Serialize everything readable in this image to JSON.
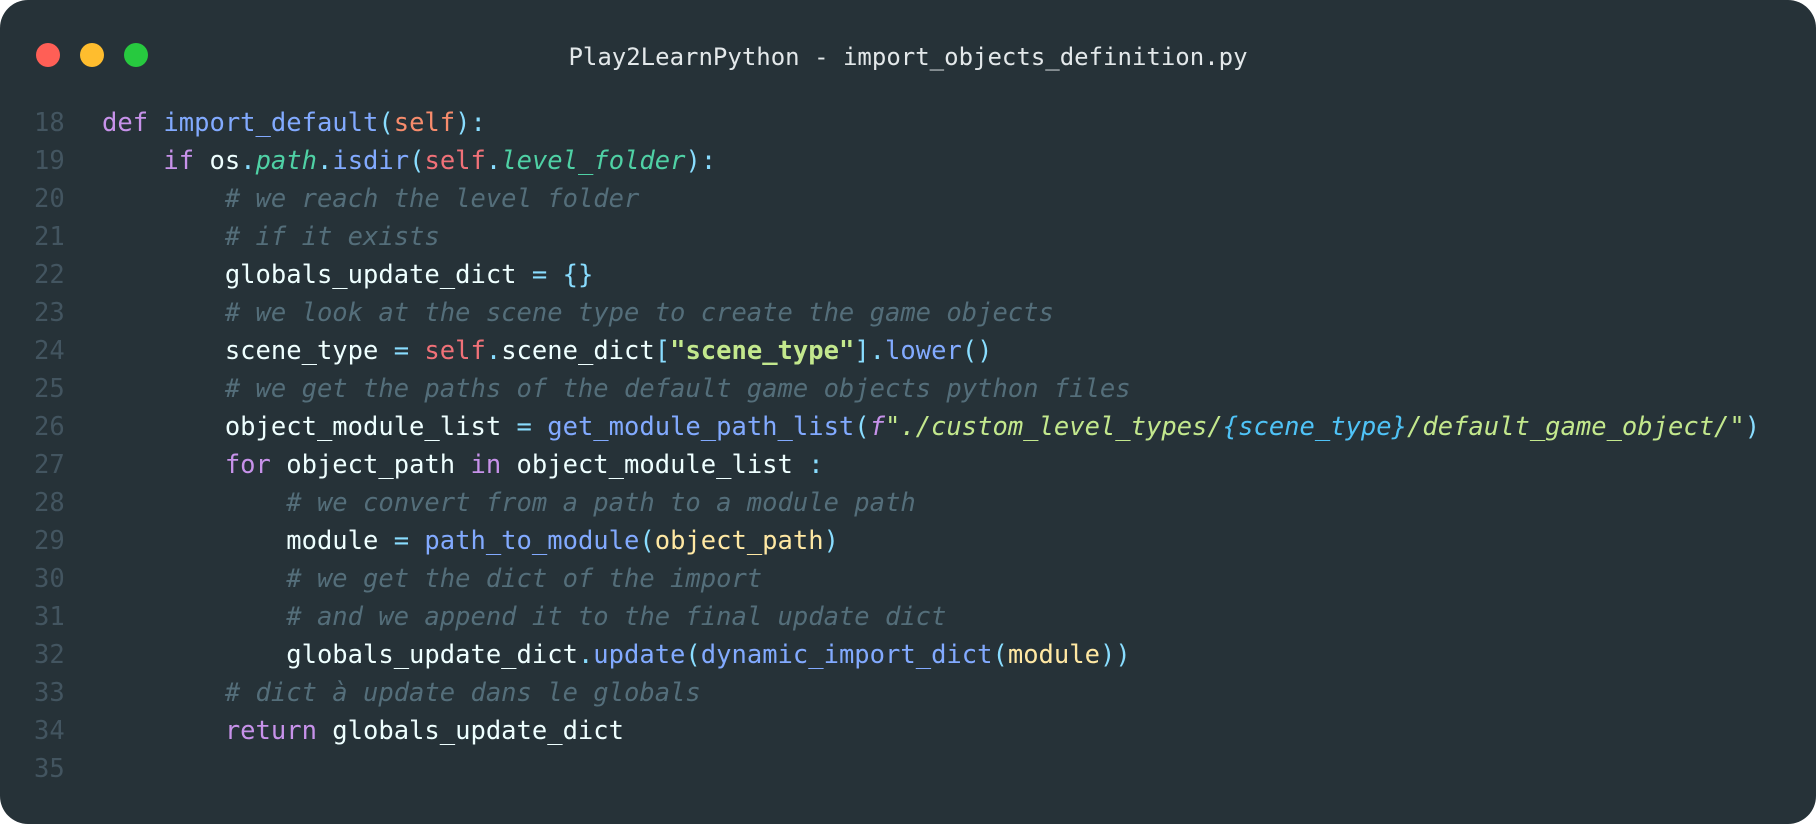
{
  "window": {
    "title": "Play2LearnPython - import_objects_definition.py",
    "traffic_lights": {
      "close_color": "#ff5f56",
      "minimize_color": "#ffbd2e",
      "zoom_color": "#27c93f"
    },
    "background_color": "#263238"
  },
  "editor": {
    "language": "python",
    "lines": [
      {
        "number": "18",
        "tokens": [
          {
            "text": "def ",
            "type": "kw"
          },
          {
            "text": "import_default",
            "type": "fn"
          },
          {
            "text": "(",
            "type": "punct"
          },
          {
            "text": "self",
            "type": "param"
          },
          {
            "text": "):",
            "type": "punct"
          }
        ]
      },
      {
        "number": "19",
        "tokens": [
          {
            "text": "    ",
            "type": "var"
          },
          {
            "text": "if ",
            "type": "kw"
          },
          {
            "text": "os",
            "type": "var"
          },
          {
            "text": ".",
            "type": "punct"
          },
          {
            "text": "path",
            "type": "path"
          },
          {
            "text": ".",
            "type": "punct"
          },
          {
            "text": "isdir",
            "type": "fn"
          },
          {
            "text": "(",
            "type": "punct"
          },
          {
            "text": "self",
            "type": "self"
          },
          {
            "text": ".",
            "type": "punct"
          },
          {
            "text": "level_folder",
            "type": "path"
          },
          {
            "text": "):",
            "type": "punct"
          }
        ]
      },
      {
        "number": "20",
        "tokens": [
          {
            "text": "        ",
            "type": "var"
          },
          {
            "text": "# we reach the level folder",
            "type": "comment"
          }
        ]
      },
      {
        "number": "21",
        "tokens": [
          {
            "text": "        ",
            "type": "var"
          },
          {
            "text": "# if it exists",
            "type": "comment"
          }
        ]
      },
      {
        "number": "22",
        "tokens": [
          {
            "text": "        ",
            "type": "var"
          },
          {
            "text": "globals_update_dict",
            "type": "var"
          },
          {
            "text": " = ",
            "type": "punct"
          },
          {
            "text": "{}",
            "type": "punct"
          }
        ]
      },
      {
        "number": "23",
        "tokens": [
          {
            "text": "        ",
            "type": "var"
          },
          {
            "text": "# we look at the scene type to create the game objects",
            "type": "comment"
          }
        ]
      },
      {
        "number": "24",
        "tokens": [
          {
            "text": "        ",
            "type": "var"
          },
          {
            "text": "scene_type",
            "type": "var"
          },
          {
            "text": " = ",
            "type": "punct"
          },
          {
            "text": "self",
            "type": "self"
          },
          {
            "text": ".",
            "type": "punct"
          },
          {
            "text": "scene_dict",
            "type": "var"
          },
          {
            "text": "[",
            "type": "punct"
          },
          {
            "text": "\"scene_type\"",
            "type": "strb"
          },
          {
            "text": "].",
            "type": "punct"
          },
          {
            "text": "lower",
            "type": "fn"
          },
          {
            "text": "()",
            "type": "punct"
          }
        ]
      },
      {
        "number": "25",
        "tokens": [
          {
            "text": "        ",
            "type": "var"
          },
          {
            "text": "# we get the paths of the default game objects python files",
            "type": "comment"
          }
        ]
      },
      {
        "number": "26",
        "tokens": [
          {
            "text": "        ",
            "type": "var"
          },
          {
            "text": "object_module_list",
            "type": "var"
          },
          {
            "text": " = ",
            "type": "punct"
          },
          {
            "text": "get_module_path_list",
            "type": "fn"
          },
          {
            "text": "(",
            "type": "punct"
          },
          {
            "text": "f",
            "type": "fmt"
          },
          {
            "text": "\"./custom_level_types/",
            "type": "stri"
          },
          {
            "text": "{scene_type}",
            "type": "interp"
          },
          {
            "text": "/default_game_object/\"",
            "type": "stri"
          },
          {
            "text": ")",
            "type": "punct"
          }
        ]
      },
      {
        "number": "27",
        "tokens": [
          {
            "text": "        ",
            "type": "var"
          },
          {
            "text": "for ",
            "type": "kw"
          },
          {
            "text": "object_path ",
            "type": "var"
          },
          {
            "text": "in ",
            "type": "kw"
          },
          {
            "text": "object_module_list ",
            "type": "var"
          },
          {
            "text": ":",
            "type": "punct"
          }
        ]
      },
      {
        "number": "28",
        "tokens": [
          {
            "text": "            ",
            "type": "var"
          },
          {
            "text": "# we convert from a path to a module path",
            "type": "comment"
          }
        ]
      },
      {
        "number": "29",
        "tokens": [
          {
            "text": "            ",
            "type": "var"
          },
          {
            "text": "module",
            "type": "var"
          },
          {
            "text": " = ",
            "type": "punct"
          },
          {
            "text": "path_to_module",
            "type": "fn"
          },
          {
            "text": "(",
            "type": "punct"
          },
          {
            "text": "object_path",
            "type": "arg"
          },
          {
            "text": ")",
            "type": "punct"
          }
        ]
      },
      {
        "number": "30",
        "tokens": [
          {
            "text": "            ",
            "type": "var"
          },
          {
            "text": "# we get the dict of the import",
            "type": "comment"
          }
        ]
      },
      {
        "number": "31",
        "tokens": [
          {
            "text": "            ",
            "type": "var"
          },
          {
            "text": "# and we append it to the final update dict",
            "type": "comment"
          }
        ]
      },
      {
        "number": "32",
        "tokens": [
          {
            "text": "            ",
            "type": "var"
          },
          {
            "text": "globals_update_dict",
            "type": "var"
          },
          {
            "text": ".",
            "type": "punct"
          },
          {
            "text": "update",
            "type": "fn"
          },
          {
            "text": "(",
            "type": "punct"
          },
          {
            "text": "dynamic_import_dict",
            "type": "fn"
          },
          {
            "text": "(",
            "type": "punct"
          },
          {
            "text": "module",
            "type": "arg"
          },
          {
            "text": "))",
            "type": "punct"
          }
        ]
      },
      {
        "number": "33",
        "tokens": [
          {
            "text": "        ",
            "type": "var"
          },
          {
            "text": "# dict à update dans le globals",
            "type": "comment"
          }
        ]
      },
      {
        "number": "34",
        "tokens": [
          {
            "text": "        ",
            "type": "var"
          },
          {
            "text": "return ",
            "type": "kw"
          },
          {
            "text": "globals_update_dict",
            "type": "var"
          }
        ]
      },
      {
        "number": "35",
        "tokens": []
      }
    ]
  }
}
